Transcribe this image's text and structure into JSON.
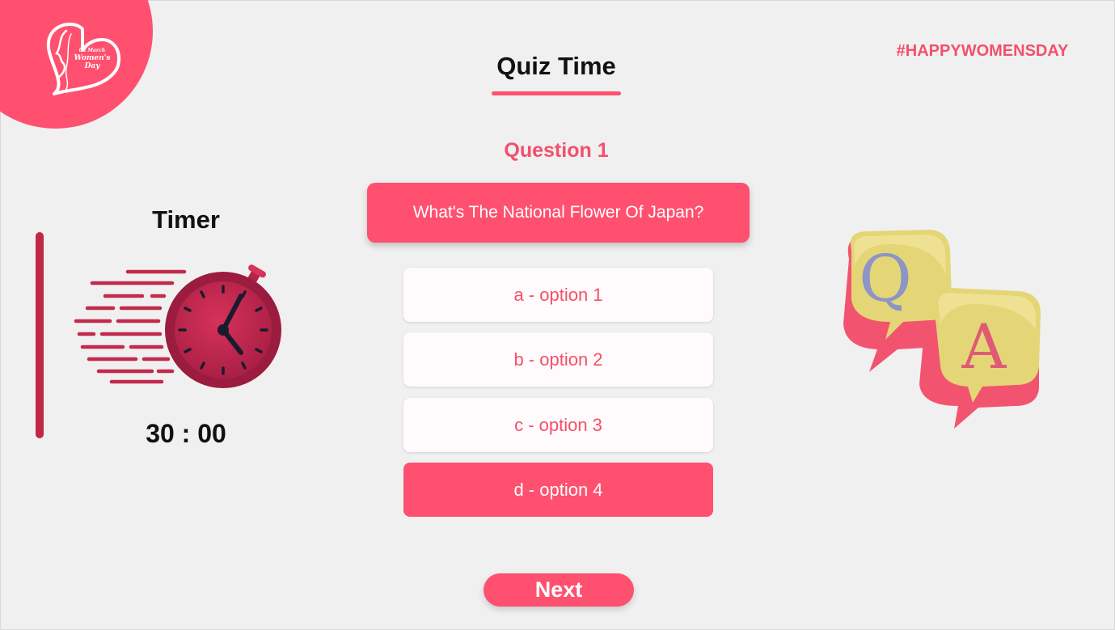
{
  "logo": {
    "line1": "08 March",
    "line2": "Women's",
    "line3": "Day",
    "icon": "heart-woman-profile-icon"
  },
  "hashtag": "#HAPPYWOMENSDAY",
  "header": {
    "title": "Quiz Time"
  },
  "question": {
    "label": "Question 1",
    "text": "What's The National Flower Of Japan?"
  },
  "options": [
    {
      "label": "a - option 1",
      "selected": false
    },
    {
      "label": "b - option 2",
      "selected": false
    },
    {
      "label": "c - option 3",
      "selected": false
    },
    {
      "label": "d - option 4",
      "selected": true
    }
  ],
  "timer": {
    "title": "Timer",
    "value": "30 : 00",
    "icon": "stopwatch-icon"
  },
  "illustration": {
    "q_letter": "Q",
    "a_letter": "A",
    "icon": "qa-speech-bubbles-icon"
  },
  "next_button": {
    "label": "Next"
  },
  "colors": {
    "accent": "#ff5070",
    "accent_text": "#f3506b",
    "timer_bar": "#c02846",
    "background": "#f0f0f0"
  }
}
